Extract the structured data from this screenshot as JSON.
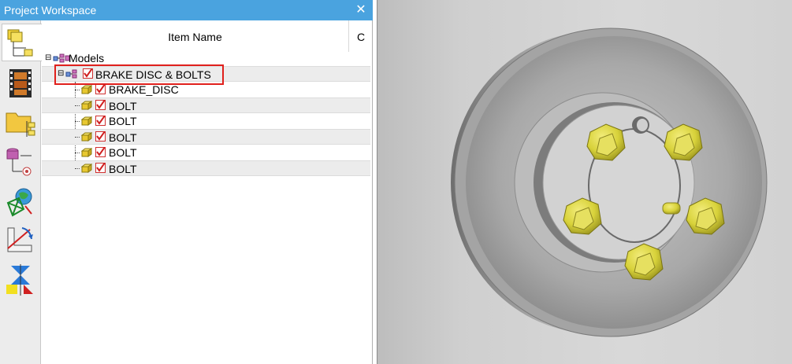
{
  "window": {
    "title": "Project Workspace",
    "close_label": "✕"
  },
  "toolbar": {
    "tools": [
      {
        "name": "model-tree-tool",
        "active": true
      },
      {
        "name": "animation-tool",
        "active": false
      },
      {
        "name": "folder-assembly-tool",
        "active": false
      },
      {
        "name": "database-tool",
        "active": false
      },
      {
        "name": "mesh-globe-tool",
        "active": false
      },
      {
        "name": "measure-tool",
        "active": false
      },
      {
        "name": "symmetry-tool",
        "active": false
      }
    ]
  },
  "tree": {
    "columns": {
      "item_name": "Item Name",
      "second": "C"
    },
    "root": {
      "label": "Models",
      "toggle": "⊟"
    },
    "assembly": {
      "label": "BRAKE DISC & BOLTS",
      "toggle": "⊟"
    },
    "parts": [
      {
        "label": "BRAKE_DISC"
      },
      {
        "label": "BOLT"
      },
      {
        "label": "BOLT"
      },
      {
        "label": "BOLT"
      },
      {
        "label": "BOLT"
      },
      {
        "label": "BOLT"
      }
    ]
  },
  "colors": {
    "titlebar": "#4aa3df",
    "highlight": "#e0201c",
    "bolt": "#d8d23a",
    "disc": "#9a9a9a"
  }
}
